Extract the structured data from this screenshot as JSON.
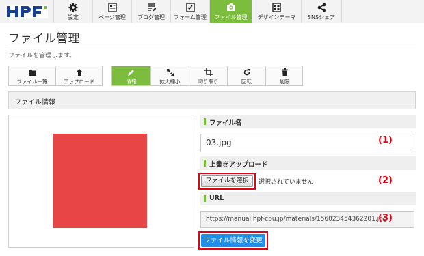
{
  "app": {
    "logo_text": "HPF"
  },
  "nav": [
    {
      "label": "設定",
      "icon": "gear-icon"
    },
    {
      "label": "ページ管理",
      "icon": "pages-icon"
    },
    {
      "label": "ブログ管理",
      "icon": "blog-icon"
    },
    {
      "label": "フォーム管理",
      "icon": "form-icon"
    },
    {
      "label": "ファイル管理",
      "icon": "camera-icon",
      "active": true
    },
    {
      "label": "デザインテーマ",
      "icon": "layout-icon"
    },
    {
      "label": "SNSシェア",
      "icon": "share-icon"
    }
  ],
  "page": {
    "title": "ファイル管理",
    "description": "ファイルを管理します。"
  },
  "toolbar": {
    "left": [
      {
        "label": "ファイル一覧",
        "icon": "folder-icon"
      },
      {
        "label": "アップロード",
        "icon": "upload-icon"
      }
    ],
    "right": [
      {
        "label": "情報",
        "icon": "pencil-icon",
        "active": true
      },
      {
        "label": "拡大縮小",
        "icon": "resize-icon"
      },
      {
        "label": "切り取り",
        "icon": "crop-icon"
      },
      {
        "label": "回転",
        "icon": "rotate-icon"
      },
      {
        "label": "削除",
        "icon": "trash-icon"
      }
    ]
  },
  "section": {
    "title": "ファイル情報"
  },
  "preview": {
    "color": "#e84646"
  },
  "fields": {
    "filename_label": "ファイル名",
    "filename_value": "03.jpg",
    "overwrite_label": "上書きアップロード",
    "choose_file_label": "ファイルを選択",
    "no_file_text": "選択されていません",
    "url_label": "URL",
    "url_value": "https://manual.hpf-cpu.jp/materials/156023454362201.jpg"
  },
  "submit_label": "ファイル情報を変更",
  "annotations": {
    "a1": "(1)",
    "a2": "(2)",
    "a3": "(3)"
  },
  "colors": {
    "accent_green": "#7cbd3e",
    "primary_blue": "#1e8ee8",
    "annotation_red": "#e60012"
  }
}
